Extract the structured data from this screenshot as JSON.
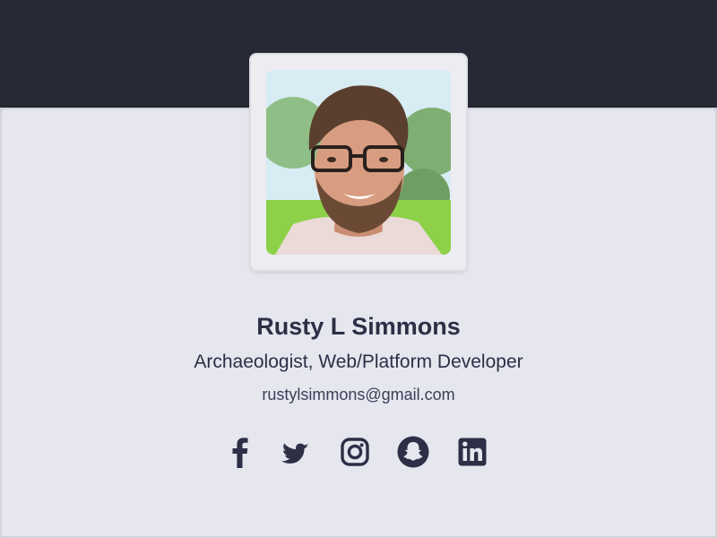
{
  "profile": {
    "name": "Rusty L Simmons",
    "title": "Archaeologist, Web/Platform Developer",
    "email": "rustylsimmons@gmail.com",
    "photo_alt": "Rusty L Simmons"
  },
  "social_links": [
    {
      "network": "Facebook",
      "icon": "facebook-icon"
    },
    {
      "network": "Twitter",
      "icon": "twitter-icon"
    },
    {
      "network": "Instagram",
      "icon": "instagram-icon"
    },
    {
      "network": "Snapchat",
      "icon": "snapchat-icon"
    },
    {
      "network": "LinkedIn",
      "icon": "linkedin-icon"
    }
  ],
  "colors": {
    "header_bg": "#272a36",
    "card_bg": "#e6e6ef",
    "text": "#2c2f45",
    "icon": "#2c2f45"
  }
}
